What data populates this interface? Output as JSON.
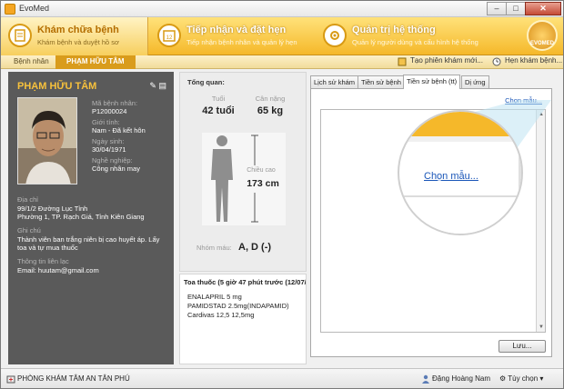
{
  "window": {
    "title": "EvoMed"
  },
  "ribbon": {
    "items": [
      {
        "title": "Khám chữa bệnh",
        "subtitle": "Khám bệnh và duyệt hồ sơ",
        "icon": "clipboard-icon"
      },
      {
        "title": "Tiếp nhận và đặt hẹn",
        "subtitle": "Tiếp nhận bệnh nhân và quản lý hẹn",
        "icon": "calendar-icon"
      },
      {
        "title": "Quản trị hệ thống",
        "subtitle": "Quản lý người dùng và cấu hình hệ thống",
        "icon": "gear-icon"
      }
    ],
    "logo_text": "EVOMED"
  },
  "breadcrumb": {
    "root": "Bệnh nhân",
    "current": "PHẠM HỮU TÂM"
  },
  "toolbar": {
    "new_session": "Tạo phiên khám mới...",
    "appointment": "Hẹn khám bệnh..."
  },
  "patient": {
    "name": "PHẠM HỮU TÂM",
    "fields": [
      {
        "label": "Mã bệnh nhân:",
        "value": "P12000024"
      },
      {
        "label": "Giới tính:",
        "value": "Nam - Đã kết hôn"
      },
      {
        "label": "Ngày sinh:",
        "value": "30/04/1971"
      },
      {
        "label": "Nghề nghiệp:",
        "value": "Công nhân may"
      }
    ],
    "address_label": "Địa chỉ",
    "address_line1": "99/1/2 Đường Lục Tỉnh",
    "address_line2": "Phường 1, TP. Rạch Giá, Tỉnh Kiên Giang",
    "note_label": "Ghi chú",
    "note_line1": "Thành viên ban trắng niên bị cao huyết áp. Lấy",
    "note_line2": "toa và tự mua thuốc",
    "contact_label": "Thông tin liên lạc",
    "contact_email": "Email: huutam@gmail.com"
  },
  "overview": {
    "title": "Tổng quan:",
    "age_label": "Tuổi",
    "age_value": "42 tuổi",
    "weight_label": "Cân nặng",
    "weight_value": "65 kg",
    "height_label": "Chiều cao",
    "height_value": "173 cm",
    "blood_label": "Nhóm máu:",
    "blood_value": "A, D (-)"
  },
  "prescription": {
    "header": "Toa thuốc (5 giờ 47 phút trước (12/07/20",
    "lines": [
      "ENALAPRIL 5 mg",
      "PAMIDSTAD 2.5mg(INDAPAMID)",
      "Cardivas 12,5 12,5mg"
    ]
  },
  "tabs": [
    {
      "label": "Lịch sử khám"
    },
    {
      "label": "Tiền sử bệnh"
    },
    {
      "label": "Tiền sử bệnh (tt)"
    },
    {
      "label": "Dị ứng"
    }
  ],
  "tab_content": {
    "template_link": "Chọn mẫu...",
    "zoom_link": "Chọn mẫu...",
    "save_button": "Lưu..."
  },
  "statusbar": {
    "clinic": "PHÒNG KHÁM TÂM AN TÂN PHÚ",
    "user": "Đặng Hoàng Nam",
    "options": "Tùy chọn"
  },
  "colors": {
    "accent": "#f5b82a",
    "panel": "#5a5a5a",
    "name": "#f7c13c",
    "link": "#1a56b8"
  }
}
